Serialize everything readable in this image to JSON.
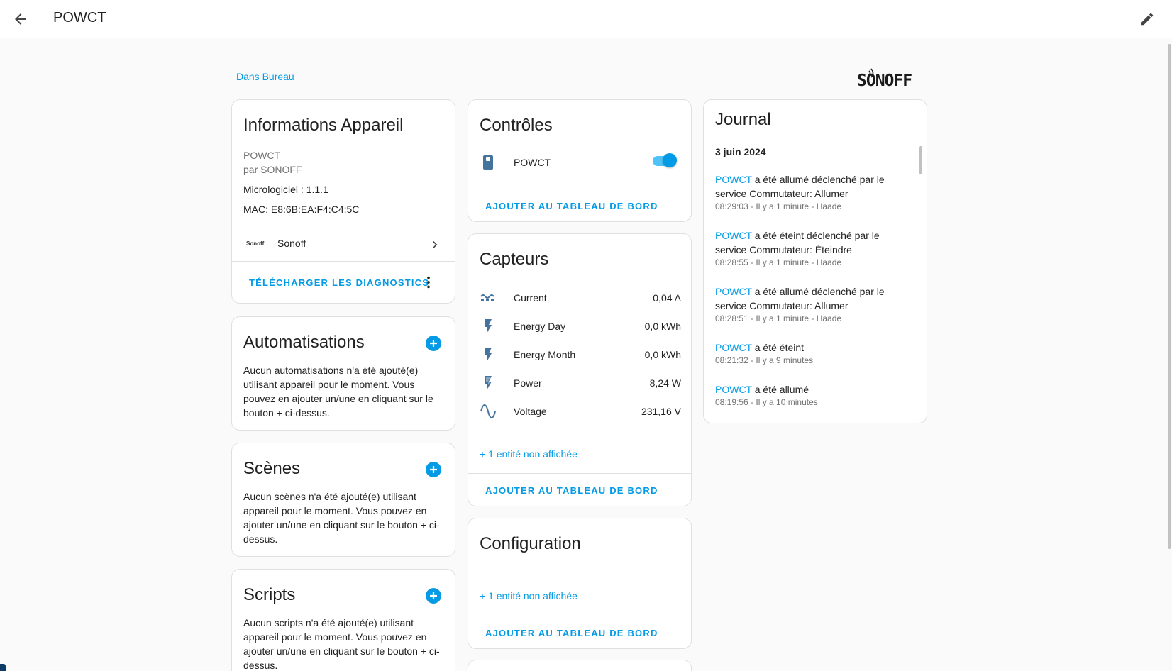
{
  "header": {
    "title": "POWCT"
  },
  "area_link": "Dans Bureau",
  "brand": "SONOFF",
  "device_info": {
    "title": "Informations Appareil",
    "model": "POWCT",
    "manufacturer": "par SONOFF",
    "firmware": "Micrologiciel : 1.1.1",
    "mac": "MAC: E8:6B:EA:F4:C4:5C",
    "integration": "Sonoff",
    "integration_logo_text": "Sonoff",
    "action": "TÉLÉCHARGER LES DIAGNOSTICS"
  },
  "automations": {
    "title": "Automatisations",
    "text": "Aucun automatisations n'a été ajouté(e) utilisant appareil pour le moment. Vous pouvez en ajouter un/une en cliquant sur le bouton + ci-dessus."
  },
  "scenes": {
    "title": "Scènes",
    "text": "Aucun scènes n'a été ajouté(e) utilisant appareil pour le moment. Vous pouvez en ajouter un/une en cliquant sur le bouton + ci-dessus."
  },
  "scripts": {
    "title": "Scripts",
    "text": "Aucun scripts n'a été ajouté(e) utilisant appareil pour le moment. Vous pouvez en ajouter un/une en cliquant sur le bouton + ci-dessus."
  },
  "controls": {
    "title": "Contrôles",
    "entity": "POWCT",
    "switch_on": true,
    "action": "AJOUTER AU TABLEAU DE BORD"
  },
  "sensors": {
    "title": "Capteurs",
    "items": [
      {
        "name": "Current",
        "value": "0,04 A",
        "icon": "current-ac-icon"
      },
      {
        "name": "Energy Day",
        "value": "0,0 kWh",
        "icon": "flash-icon"
      },
      {
        "name": "Energy Month",
        "value": "0,0 kWh",
        "icon": "flash-icon"
      },
      {
        "name": "Power",
        "value": "8,24 W",
        "icon": "flash-outline-icon"
      },
      {
        "name": "Voltage",
        "value": "231,16 V",
        "icon": "sine-wave-icon"
      }
    ],
    "more": "+ 1 entité non affichée",
    "action": "AJOUTER AU TABLEAU DE BORD"
  },
  "configuration": {
    "title": "Configuration",
    "more": "+ 1 entité non affichée",
    "action": "AJOUTER AU TABLEAU DE BORD"
  },
  "journal": {
    "title": "Journal",
    "date": "3 juin 2024",
    "entries": [
      {
        "entity": "POWCT",
        "message": " a été allumé déclenché par le service Commutateur: Allumer",
        "meta": "08:29:03 - Il y a 1 minute - Haade"
      },
      {
        "entity": "POWCT",
        "message": " a été éteint déclenché par le service Commutateur: Éteindre",
        "meta": "08:28:55 - Il y a 1 minute - Haade"
      },
      {
        "entity": "POWCT",
        "message": " a été allumé déclenché par le service Commutateur: Allumer",
        "meta": "08:28:51 - Il y a 1 minute - Haade"
      },
      {
        "entity": "POWCT",
        "message": " a été éteint",
        "meta": "08:21:32 - Il y a 9 minutes"
      },
      {
        "entity": "POWCT",
        "message": " a été allumé",
        "meta": "08:19:56 - Il y a 10 minutes"
      }
    ]
  },
  "colors": {
    "accent": "#039be5",
    "switch_track": "#4fc3f7",
    "text": "#212121",
    "secondary": "#727272"
  }
}
